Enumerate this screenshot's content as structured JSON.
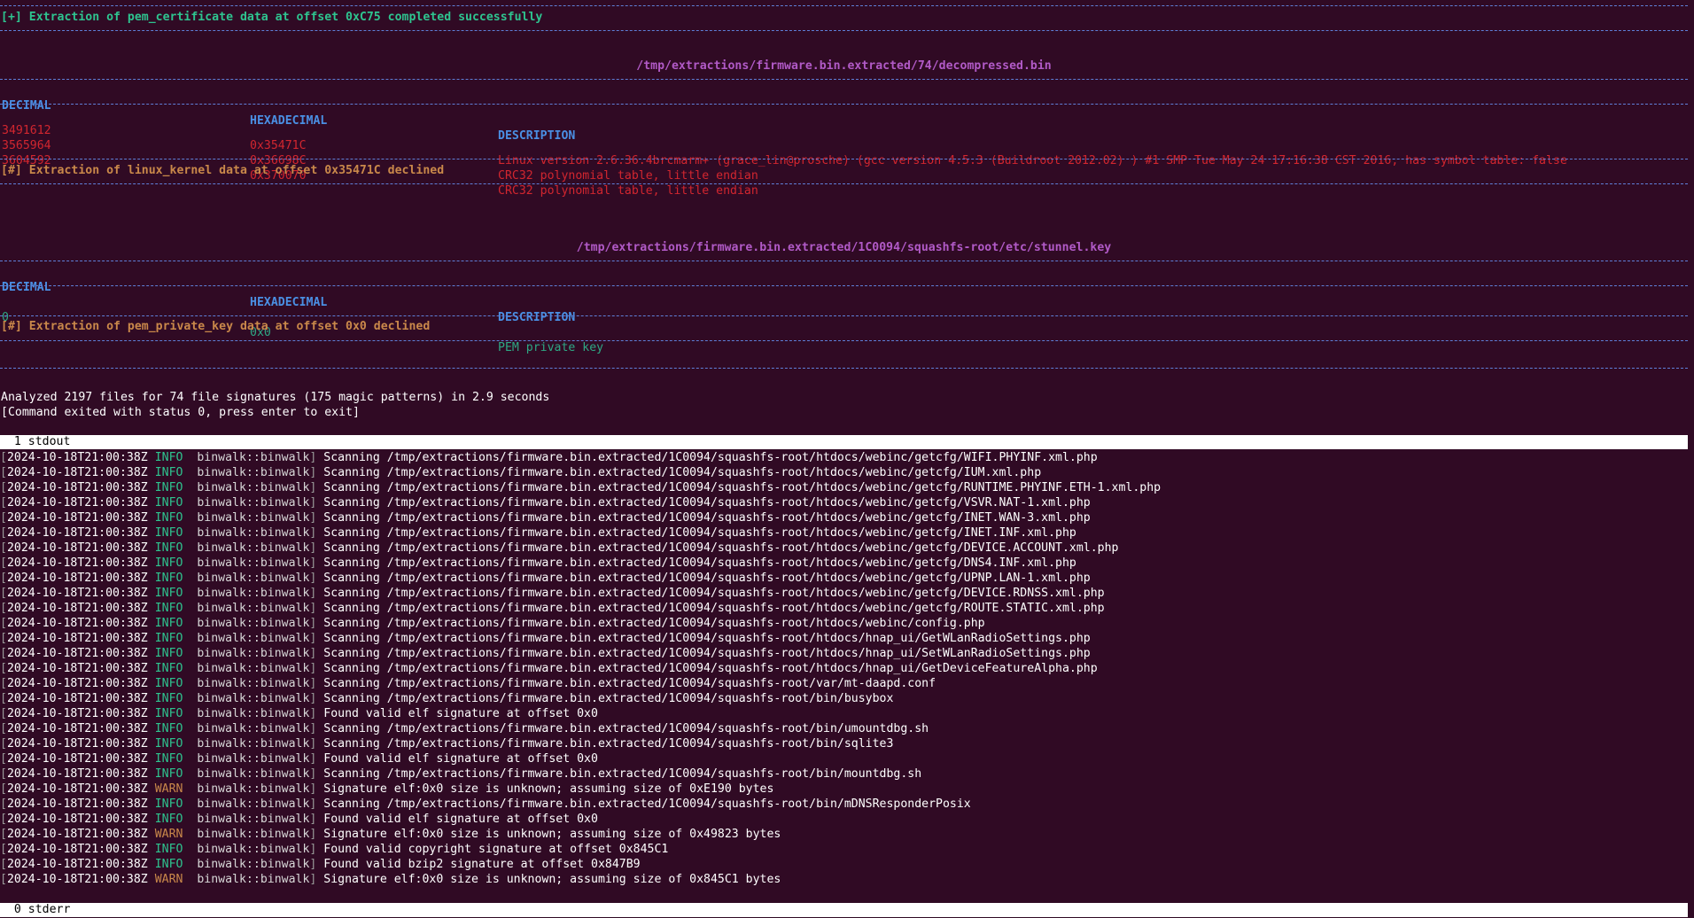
{
  "top_section": {
    "success_message": "[+] Extraction of pem_certificate data at offset 0xC75 completed successfully"
  },
  "blocks": [
    {
      "file_path": "/tmp/extractions/firmware.bin.extracted/74/decompressed.bin",
      "headers": {
        "decimal": "DECIMAL",
        "hex": "HEXADECIMAL",
        "desc": "DESCRIPTION"
      },
      "rows": [
        {
          "decimal": "3491612",
          "hex": "0x35471C",
          "desc": "Linux version 2.6.36.4brcmarm+ (grace_lin@prosche) (gcc version 4.5.3 (Buildroot 2012.02) ) #1 SMP Tue May 24 17:16:38 CST 2016, has symbol table: false"
        },
        {
          "decimal": "3565964",
          "hex": "0x36698C",
          "desc": "CRC32 polynomial table, little endian"
        },
        {
          "decimal": "3604592",
          "hex": "0x370070",
          "desc": "CRC32 polynomial table, little endian"
        }
      ],
      "status": "[#] Extraction of linux_kernel data at offset 0x35471C declined"
    },
    {
      "file_path": "/tmp/extractions/firmware.bin.extracted/1C0094/squashfs-root/etc/stunnel.key",
      "headers": {
        "decimal": "DECIMAL",
        "hex": "HEXADECIMAL",
        "desc": "DESCRIPTION"
      },
      "rows": [
        {
          "decimal": "0",
          "hex": "0x0",
          "desc": "PEM private key"
        }
      ],
      "status": "[#] Extraction of pem_private_key data at offset 0x0 declined"
    }
  ],
  "summary": {
    "analyzed": "Analyzed 2197 files for 74 file signatures (175 magic patterns) in 2.9 seconds",
    "exit_msg": "[Command exited with status 0, press enter to exit]"
  },
  "panes": {
    "stdout_label": "  1 stdout",
    "stderr_label": "  0 stderr"
  },
  "log": {
    "timestamp": "2024-10-18T21:00:38Z",
    "module": "binwalk::binwalk",
    "entries": [
      {
        "level": "INFO",
        "msg": "Scanning /tmp/extractions/firmware.bin.extracted/1C0094/squashfs-root/htdocs/webinc/getcfg/WIFI.PHYINF.xml.php"
      },
      {
        "level": "INFO",
        "msg": "Scanning /tmp/extractions/firmware.bin.extracted/1C0094/squashfs-root/htdocs/webinc/getcfg/IUM.xml.php"
      },
      {
        "level": "INFO",
        "msg": "Scanning /tmp/extractions/firmware.bin.extracted/1C0094/squashfs-root/htdocs/webinc/getcfg/RUNTIME.PHYINF.ETH-1.xml.php"
      },
      {
        "level": "INFO",
        "msg": "Scanning /tmp/extractions/firmware.bin.extracted/1C0094/squashfs-root/htdocs/webinc/getcfg/VSVR.NAT-1.xml.php"
      },
      {
        "level": "INFO",
        "msg": "Scanning /tmp/extractions/firmware.bin.extracted/1C0094/squashfs-root/htdocs/webinc/getcfg/INET.WAN-3.xml.php"
      },
      {
        "level": "INFO",
        "msg": "Scanning /tmp/extractions/firmware.bin.extracted/1C0094/squashfs-root/htdocs/webinc/getcfg/INET.INF.xml.php"
      },
      {
        "level": "INFO",
        "msg": "Scanning /tmp/extractions/firmware.bin.extracted/1C0094/squashfs-root/htdocs/webinc/getcfg/DEVICE.ACCOUNT.xml.php"
      },
      {
        "level": "INFO",
        "msg": "Scanning /tmp/extractions/firmware.bin.extracted/1C0094/squashfs-root/htdocs/webinc/getcfg/DNS4.INF.xml.php"
      },
      {
        "level": "INFO",
        "msg": "Scanning /tmp/extractions/firmware.bin.extracted/1C0094/squashfs-root/htdocs/webinc/getcfg/UPNP.LAN-1.xml.php"
      },
      {
        "level": "INFO",
        "msg": "Scanning /tmp/extractions/firmware.bin.extracted/1C0094/squashfs-root/htdocs/webinc/getcfg/DEVICE.RDNSS.xml.php"
      },
      {
        "level": "INFO",
        "msg": "Scanning /tmp/extractions/firmware.bin.extracted/1C0094/squashfs-root/htdocs/webinc/getcfg/ROUTE.STATIC.xml.php"
      },
      {
        "level": "INFO",
        "msg": "Scanning /tmp/extractions/firmware.bin.extracted/1C0094/squashfs-root/htdocs/webinc/config.php"
      },
      {
        "level": "INFO",
        "msg": "Scanning /tmp/extractions/firmware.bin.extracted/1C0094/squashfs-root/htdocs/hnap_ui/GetWLanRadioSettings.php"
      },
      {
        "level": "INFO",
        "msg": "Scanning /tmp/extractions/firmware.bin.extracted/1C0094/squashfs-root/htdocs/hnap_ui/SetWLanRadioSettings.php"
      },
      {
        "level": "INFO",
        "msg": "Scanning /tmp/extractions/firmware.bin.extracted/1C0094/squashfs-root/htdocs/hnap_ui/GetDeviceFeatureAlpha.php"
      },
      {
        "level": "INFO",
        "msg": "Scanning /tmp/extractions/firmware.bin.extracted/1C0094/squashfs-root/var/mt-daapd.conf"
      },
      {
        "level": "INFO",
        "msg": "Scanning /tmp/extractions/firmware.bin.extracted/1C0094/squashfs-root/bin/busybox"
      },
      {
        "level": "INFO",
        "msg": "Found valid elf signature at offset 0x0"
      },
      {
        "level": "INFO",
        "msg": "Scanning /tmp/extractions/firmware.bin.extracted/1C0094/squashfs-root/bin/umountdbg.sh"
      },
      {
        "level": "INFO",
        "msg": "Scanning /tmp/extractions/firmware.bin.extracted/1C0094/squashfs-root/bin/sqlite3"
      },
      {
        "level": "INFO",
        "msg": "Found valid elf signature at offset 0x0"
      },
      {
        "level": "INFO",
        "msg": "Scanning /tmp/extractions/firmware.bin.extracted/1C0094/squashfs-root/bin/mountdbg.sh"
      },
      {
        "level": "WARN",
        "msg": "Signature elf:0x0 size is unknown; assuming size of 0xE190 bytes"
      },
      {
        "level": "INFO",
        "msg": "Scanning /tmp/extractions/firmware.bin.extracted/1C0094/squashfs-root/bin/mDNSResponderPosix"
      },
      {
        "level": "INFO",
        "msg": "Found valid elf signature at offset 0x0"
      },
      {
        "level": "WARN",
        "msg": "Signature elf:0x0 size is unknown; assuming size of 0x49823 bytes"
      },
      {
        "level": "INFO",
        "msg": "Found valid copyright signature at offset 0x845C1"
      },
      {
        "level": "INFO",
        "msg": "Found valid bzip2 signature at offset 0x847B9"
      },
      {
        "level": "WARN",
        "msg": "Signature elf:0x0 size is unknown; assuming size of 0x845C1 bytes"
      }
    ]
  },
  "colors": {
    "background": "#300a24",
    "dash": "#5f7fd8",
    "success": "#2ec48f",
    "declined": "#c9884a",
    "path": "#b15ac7",
    "header": "#4a8fe3",
    "row_red": "#d2262f",
    "row_green": "#2ea884"
  }
}
